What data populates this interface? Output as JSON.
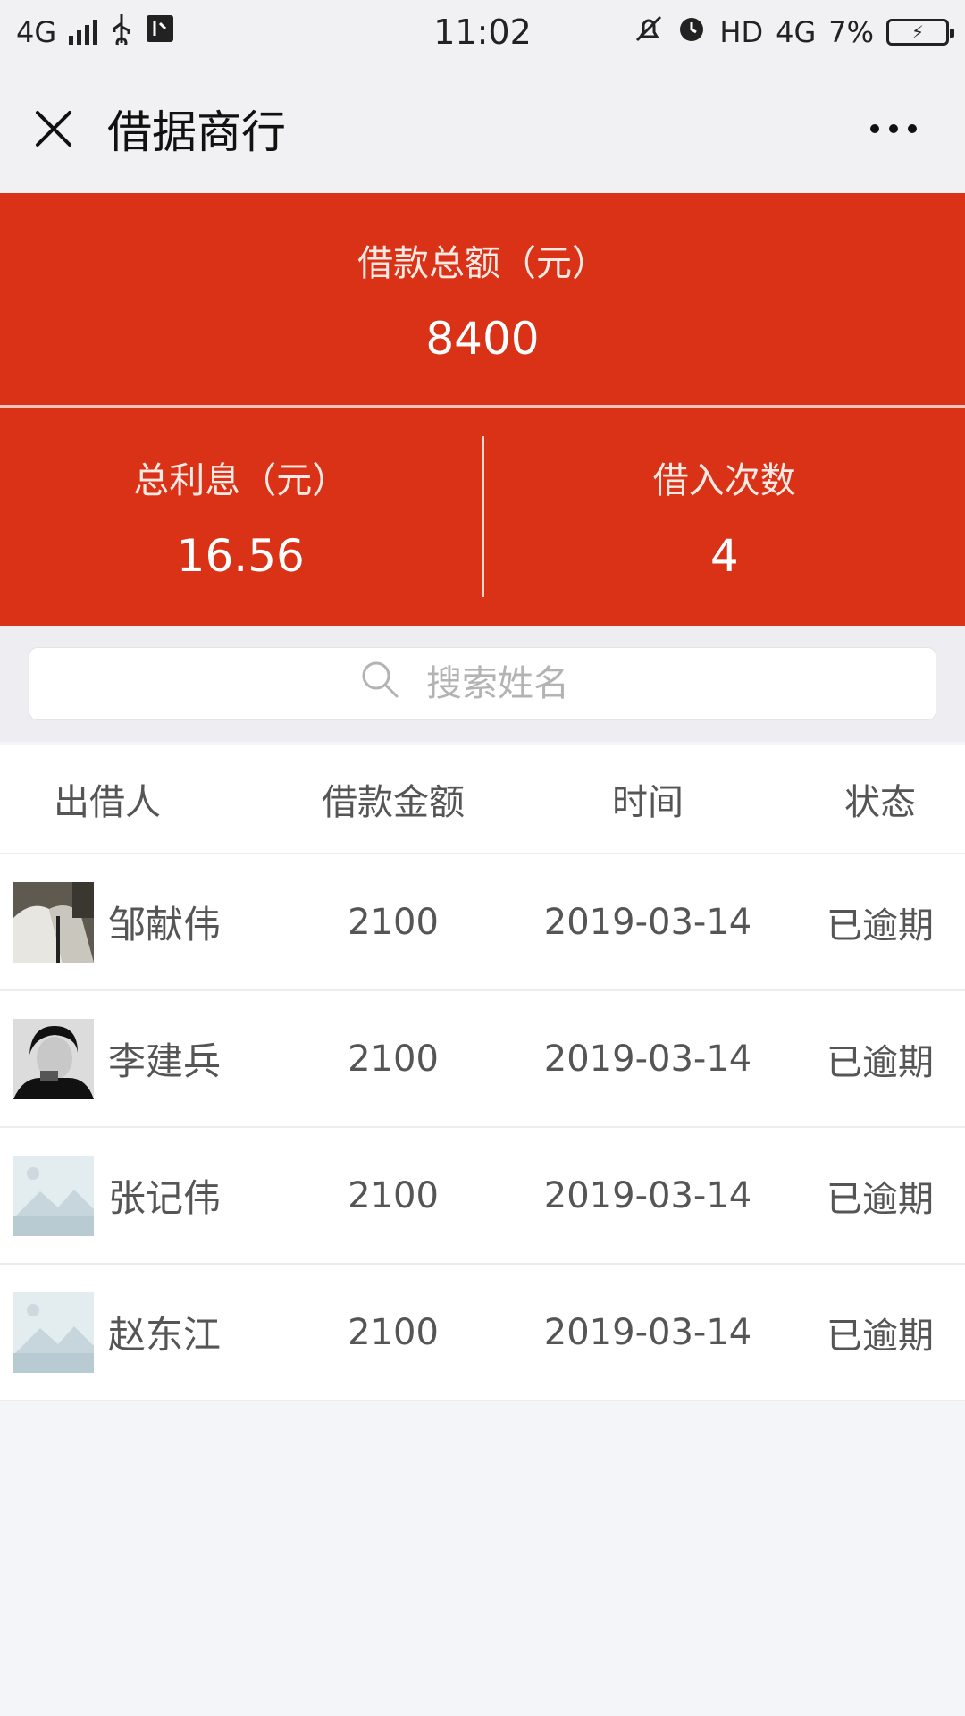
{
  "status_bar": {
    "network": "4G",
    "time": "11:02",
    "hd": "HD",
    "network_right": "4G",
    "battery": "7%",
    "icons": [
      "signal-icon",
      "usb-icon",
      "usb-debug-icon",
      "mute-icon",
      "alarm-icon",
      "battery-icon"
    ]
  },
  "nav": {
    "title": "借据商行",
    "close_icon": "close-icon",
    "more_icon": "more-icon"
  },
  "summary": {
    "total_label": "借款总额（元）",
    "total_value": "8400",
    "interest_label": "总利息（元）",
    "interest_value": "16.56",
    "count_label": "借入次数",
    "count_value": "4"
  },
  "search": {
    "placeholder": "搜索姓名",
    "icon": "search-icon"
  },
  "table": {
    "headers": [
      "出借人",
      "借款金额",
      "时间",
      "状态"
    ],
    "rows": [
      {
        "name": "邹献伟",
        "amount": "2100",
        "time": "2019-03-14",
        "status": "已逾期",
        "avatar": "photo-light"
      },
      {
        "name": "李建兵",
        "amount": "2100",
        "time": "2019-03-14",
        "status": "已逾期",
        "avatar": "photo-dark"
      },
      {
        "name": "张记伟",
        "amount": "2100",
        "time": "2019-03-14",
        "status": "已逾期",
        "avatar": "placeholder"
      },
      {
        "name": "赵东江",
        "amount": "2100",
        "time": "2019-03-14",
        "status": "已逾期",
        "avatar": "placeholder"
      }
    ]
  },
  "colors": {
    "accent": "#d93217",
    "background": "#f4f5f9",
    "text": "#555555"
  }
}
